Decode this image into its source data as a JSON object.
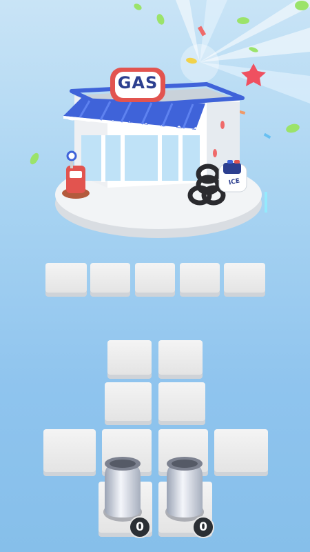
{
  "store": {
    "sign_text": "GAS",
    "police_car_text": "ICE"
  },
  "pipes": [
    {
      "count": "0"
    },
    {
      "count": "0"
    }
  ],
  "colors": {
    "sky_top": "#c9e4f6",
    "sky_bottom": "#86bfea",
    "tile": "#ececec",
    "awning_blue": "#3f63d9",
    "pump_red": "#e2544f",
    "counter_bg": "#2b2f34"
  }
}
